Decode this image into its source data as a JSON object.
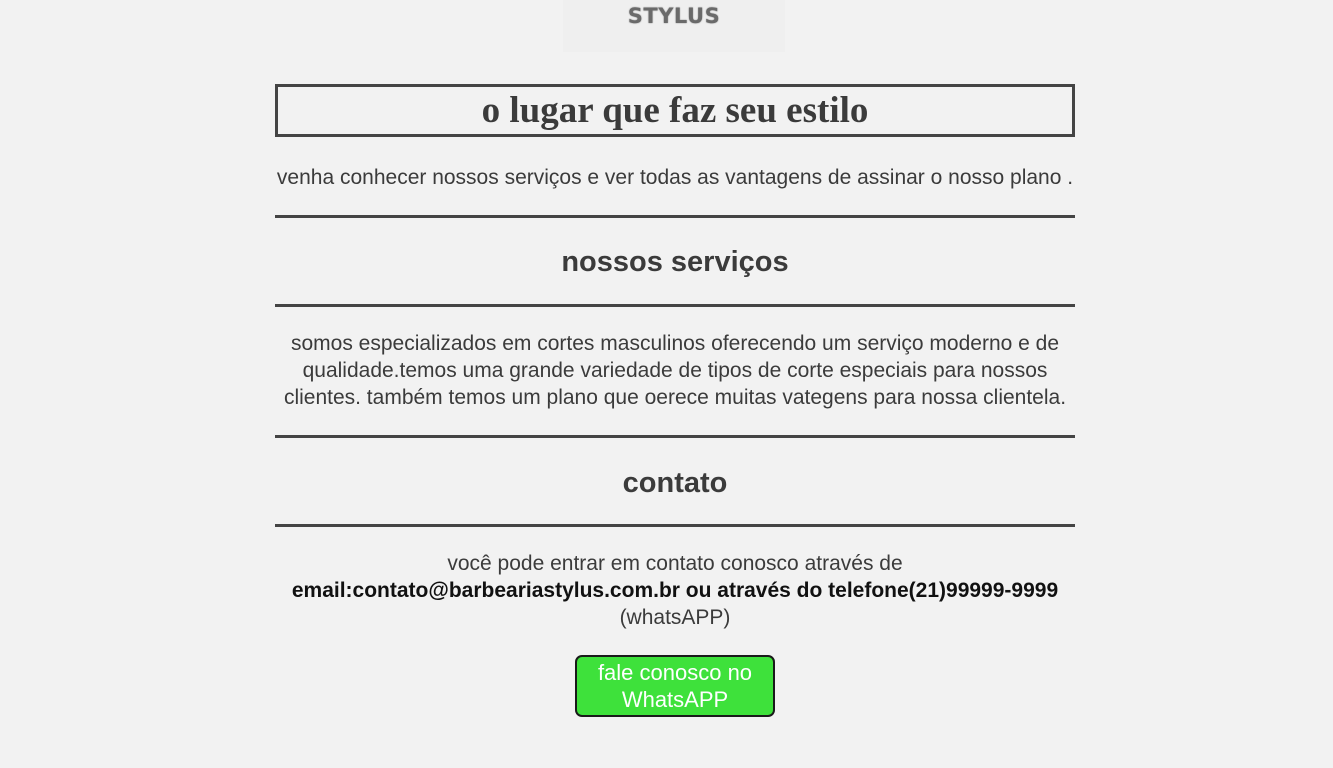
{
  "header": {
    "logo_text": "STYLUS"
  },
  "hero": {
    "title": "o lugar que faz seu estilo"
  },
  "intro": {
    "text": "venha conhecer nossos serviços e ver todas as vantagens de assinar o nosso plano ."
  },
  "services": {
    "title": "nossos serviços",
    "text": "somos especializados em cortes masculinos oferecendo um serviço moderno e de qualidade.temos uma grande variedade de tipos de corte especiais para nossos clientes. também temos um plano que oerece muitas vategens para nossa clientela."
  },
  "contact": {
    "title": "contato",
    "text_before": "você pode entrar em contato conosco através de ",
    "text_bold": "email:contato@barbeariastylus.com.br ou através do telefone(21)99999-9999",
    "text_after": " (whatsAPP)",
    "button_label": "fale conosco no WhatsAPP"
  },
  "colors": {
    "background": "#f2f2f2",
    "text": "#3b3b3b",
    "rule": "#444444",
    "whatsapp_button": "#3ee13b"
  }
}
